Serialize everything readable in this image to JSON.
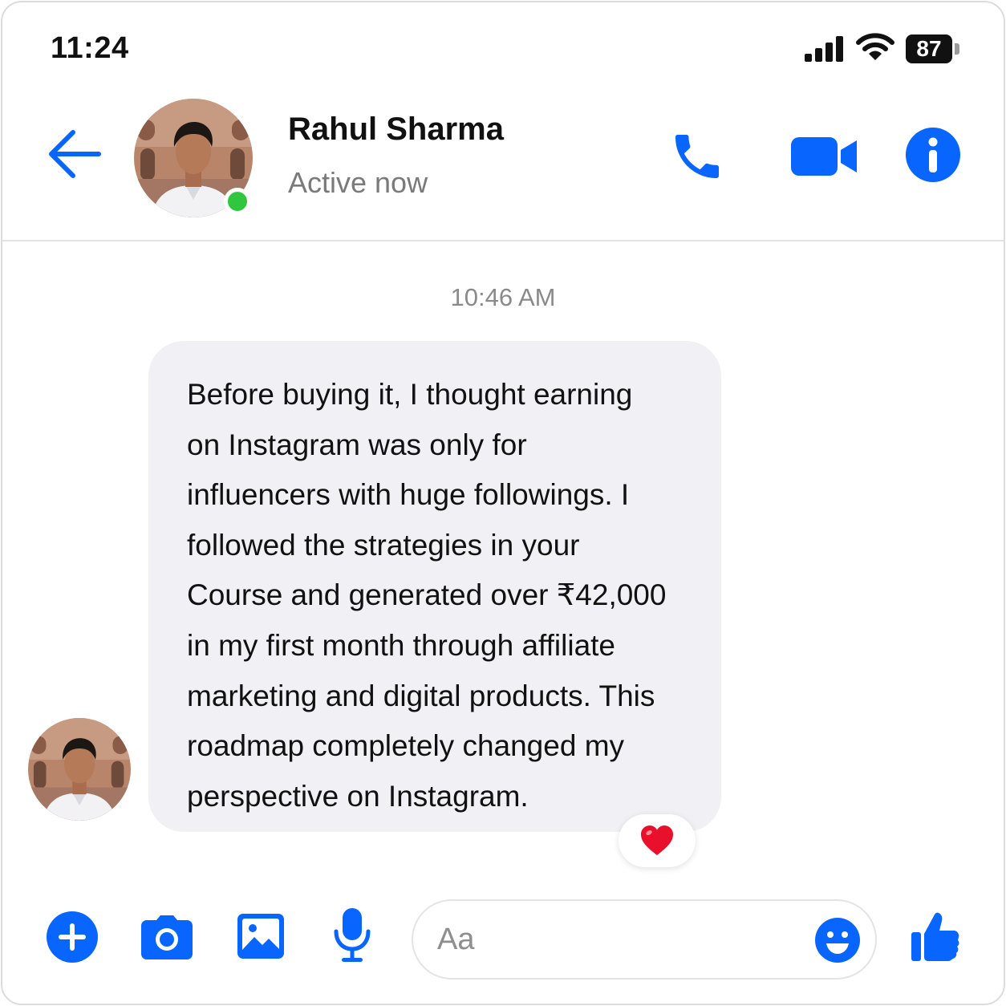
{
  "status_bar": {
    "time": "11:24",
    "battery": "87",
    "signal_icon": "cellular-signal-icon",
    "wifi_icon": "wifi-icon"
  },
  "header": {
    "back_icon": "arrow-left-icon",
    "contact_name": "Rahul Sharma",
    "contact_status": "Active now",
    "online": true,
    "actions": [
      "phone-icon",
      "video-camera-icon",
      "info-icon"
    ]
  },
  "conversation": {
    "timestamp": "10:46 AM",
    "messages": [
      {
        "sender": "Rahul Sharma",
        "direction": "incoming",
        "lines": [
          "Before buying it, I thought earning",
          "on Instagram was only for",
          "influencers with huge followings. I",
          "followed the strategies in your",
          "Course and generated over ₹42,000",
          "in my first month through affiliate",
          "marketing and digital products. This",
          "roadmap completely changed my",
          "perspective on Instagram."
        ],
        "reaction": "❤️"
      }
    ]
  },
  "composer": {
    "placeholder": "Aa",
    "value": "",
    "icons": [
      "plus-circle-icon",
      "camera-icon",
      "image-gallery-icon",
      "microphone-icon",
      "emoji-icon",
      "thumbs-up-icon"
    ]
  },
  "colors": {
    "accent": "#0866ff",
    "online": "#31c63f",
    "bubble": "#f0f0f5",
    "muted_text": "#7a7a7a"
  }
}
